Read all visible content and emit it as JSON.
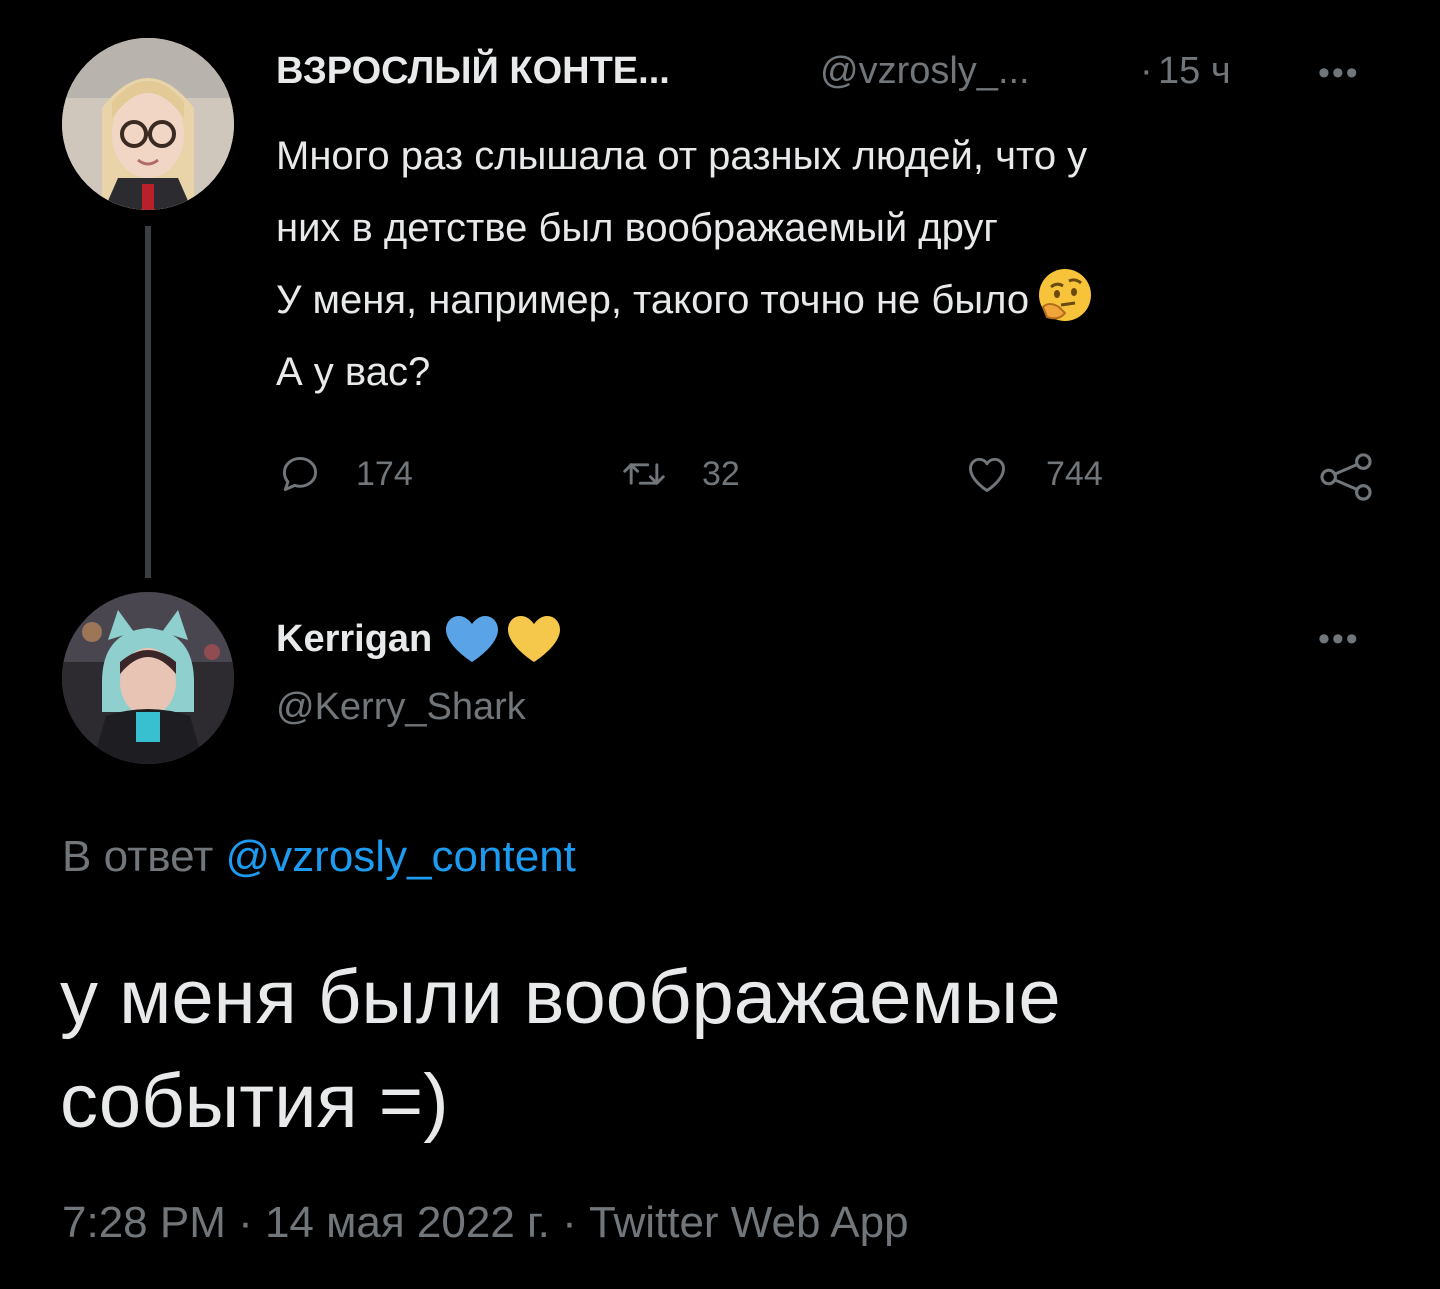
{
  "parent_tweet": {
    "display_name": "ВЗРОСЛЫЙ КОНТЕ...",
    "handle": "@vzrosly_...",
    "separator": "·",
    "time_ago": "15 ч",
    "more": "•••",
    "body_lines": [
      "Много раз слышала от разных людей, что у",
      "них в детстве был воображаемый друг",
      "У меня, например, такого точно не было",
      "А у вас?"
    ],
    "emoji_icon": "thinking-face-emoji",
    "actions": {
      "replies": "174",
      "retweets": "32",
      "likes": "744"
    }
  },
  "reply_tweet": {
    "display_name": "Kerrigan",
    "name_emojis": [
      "blue-heart-icon",
      "yellow-heart-icon"
    ],
    "handle": "@Kerry_Shark",
    "more": "•••",
    "reply_to_prefix": "В ответ",
    "reply_to_handle": "@vzrosly_content",
    "body_lines": [
      "у меня были воображаемые",
      "события =)"
    ],
    "meta": "7:28 PM · 14 мая 2022 г. · Twitter Web App"
  },
  "colors": {
    "background": "#000000",
    "text": "#e7e9ea",
    "muted": "#71767b",
    "link": "#1d9bf0",
    "thread_line": "#3b3f42",
    "heart_blue": "#5aa3e6",
    "heart_yellow": "#f5c84c"
  }
}
